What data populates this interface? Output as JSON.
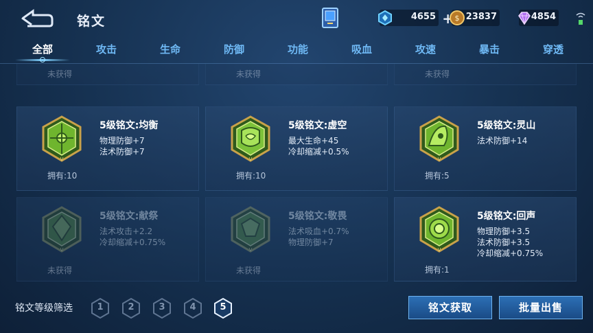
{
  "header": {
    "title": "铭文",
    "back_icon": "back-arrow-icon",
    "book_icon": "inscription-book-icon"
  },
  "currencies": [
    {
      "name": "coupon",
      "value": "4655",
      "icon": "diamond-coupon-icon",
      "color": "#59c6ff"
    },
    {
      "name": "gold",
      "value": "23837",
      "icon": "gold-coin-icon",
      "color": "#e0a646"
    },
    {
      "name": "gem",
      "value": "4854",
      "icon": "purple-gem-icon",
      "color": "#c58cff"
    }
  ],
  "tabs": [
    "全部",
    "攻击",
    "生命",
    "防御",
    "功能",
    "吸血",
    "攻速",
    "暴击",
    "穿透"
  ],
  "active_tab": 0,
  "cards": [
    {
      "name": "",
      "attrs": [],
      "owned": "",
      "status": "未获得",
      "dim": true
    },
    {
      "name": "",
      "attrs": [],
      "owned": "",
      "status": "未获得",
      "dim": true
    },
    {
      "name": "",
      "attrs": [],
      "owned": "",
      "status": "未获得",
      "dim": true
    },
    {
      "name": "5级铭文:均衡",
      "attrs": [
        "物理防御+7",
        "法术防御+7"
      ],
      "owned": "拥有:10",
      "status": "",
      "dim": false
    },
    {
      "name": "5级铭文:虚空",
      "attrs": [
        "最大生命+45",
        "冷却缩减+0.5%"
      ],
      "owned": "拥有:10",
      "status": "",
      "dim": false
    },
    {
      "name": "5级铭文:灵山",
      "attrs": [
        "法术防御+14"
      ],
      "owned": "拥有:5",
      "status": "",
      "dim": false
    },
    {
      "name": "5级铭文:献祭",
      "attrs": [
        "法术攻击+2.2",
        "冷却缩减+0.75%"
      ],
      "owned": "",
      "status": "未获得",
      "dim": true
    },
    {
      "name": "5级铭文:敬畏",
      "attrs": [
        "法术吸血+0.7%",
        "物理防御+7"
      ],
      "owned": "",
      "status": "未获得",
      "dim": true
    },
    {
      "name": "5级铭文:回声",
      "attrs": [
        "物理防御+3.5",
        "法术防御+3.5",
        "冷却缩减+0.75%"
      ],
      "owned": "拥有:1",
      "status": "",
      "dim": false
    }
  ],
  "footer": {
    "filter_label": "铭文等级筛选",
    "levels": [
      "1",
      "2",
      "3",
      "4",
      "5"
    ],
    "active_level": "5",
    "get_button": "铭文获取",
    "sell_button": "批量出售"
  },
  "colors": {
    "accent": "#6fb9f5",
    "emblem_green": "#8bd33a",
    "emblem_gold": "#c9a24a"
  }
}
